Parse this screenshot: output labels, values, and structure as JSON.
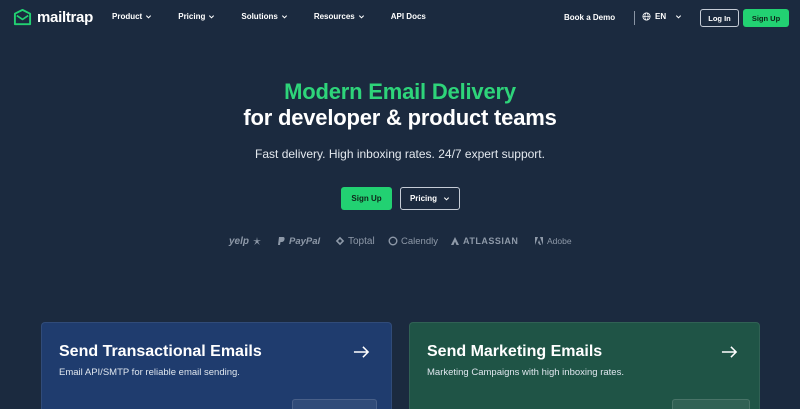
{
  "brand": {
    "name": "mailtrap"
  },
  "nav": {
    "links": [
      {
        "label": "Product",
        "has_dropdown": true
      },
      {
        "label": "Pricing",
        "has_dropdown": true
      },
      {
        "label": "Solutions",
        "has_dropdown": true
      },
      {
        "label": "Resources",
        "has_dropdown": true
      },
      {
        "label": "API Docs",
        "has_dropdown": false
      }
    ],
    "book_demo": "Book a Demo",
    "language": "EN",
    "login": "Log In",
    "signup": "Sign Up"
  },
  "hero": {
    "title_line1": "Modern Email Delivery",
    "title_line2": "for developer & product teams",
    "subtitle": "Fast delivery. High inboxing rates. 24/7 expert support.",
    "primary_cta": "Sign Up",
    "secondary_cta": "Pricing"
  },
  "logos": {
    "yelp": "yelp",
    "paypal": "PayPal",
    "toptal": "Toptal",
    "calendly": "Calendly",
    "atlassian": "ATLASSIAN",
    "adobe": "Adobe"
  },
  "cards": [
    {
      "title": "Send Transactional Emails",
      "description": "Email API/SMTP for reliable email sending."
    },
    {
      "title": "Send Marketing Emails",
      "description": "Marketing Campaigns with high inboxing rates."
    }
  ],
  "colors": {
    "background": "#1b2a3f",
    "accent_green": "#22d172",
    "headline_green": "#2ed47a",
    "card_transactional": "#1f3c6e",
    "card_marketing": "#1f5446",
    "logo_gray": "#8e99a8"
  },
  "icons": {
    "logo_mark": "mailtrap-logo-icon",
    "globe": "globe-icon",
    "chevron": "chevron-down-icon",
    "arrow": "arrow-right-icon"
  }
}
